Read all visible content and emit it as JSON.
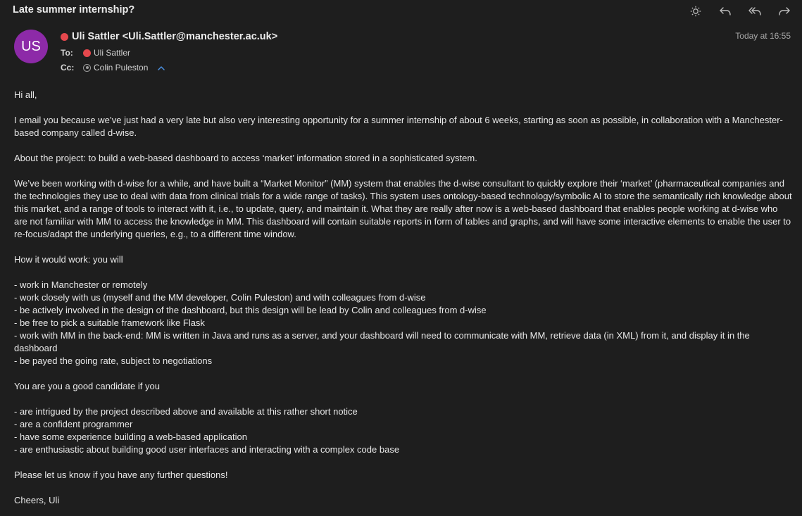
{
  "subject": "Late summer internship?",
  "toolbar": {
    "icons": [
      "brightness-icon",
      "reply-icon",
      "reply-all-icon",
      "forward-icon"
    ]
  },
  "sender": {
    "initials": "US",
    "avatar_color": "#8d2aa8",
    "display": "Uli Sattler <Uli.Sattler@manchester.ac.uk>",
    "status_color": "#e5484d"
  },
  "datetime": "Today at 16:55",
  "recipients": {
    "to_label": "To:",
    "to": "Uli Sattler",
    "cc_label": "Cc:",
    "cc": "Colin Puleston"
  },
  "body": {
    "greeting": "Hi all,",
    "p1": "I email you because we’ve just had a very late but also very interesting opportunity for a summer internship of about 6 weeks, starting as soon as possible, in collaboration with a Manchester-based company called d-wise.",
    "p2": "About the project: to build a web-based dashboard to access ‘market’ information stored in a sophisticated system.",
    "p3": "We’ve been working with d-wise for a while, and have built a “Market Monitor” (MM) system that enables the d-wise consultant to quickly explore their ‘market’ (pharmaceutical companies and the technologies they use to deal with data from clinical trials for a wide range of tasks). This system uses ontology-based technology/symbolic AI to store the semantically rich knowledge about this market, and a range of tools to interact with it, i.e., to update, query, and maintain it. What they are really after now is a web-based dashboard that enables people working at d-wise who are not familiar with MM to access the knowledge in MM. This dashboard will contain suitable reports in form of tables and graphs, and will have some interactive elements to enable the user to re-focus/adapt the underlying queries, e.g., to a different time window.",
    "p4": "How it would work: you will",
    "list1": [
      "- work in Manchester or remotely",
      "- work closely with us (myself and the MM developer, Colin Puleston) and with colleagues from d-wise",
      "- be actively involved in the design of the dashboard, but this design will be lead by Colin and colleagues from d-wise",
      "- be free to pick a suitable framework like Flask",
      "- work with MM in the back-end: MM is written in Java and runs as a server, and your dashboard will need to communicate with MM, retrieve data (in XML) from it, and display it in the dashboard",
      "- be payed the going rate, subject to negotiations"
    ],
    "p5": "You are you a good candidate if you",
    "list2": [
      "- are intrigued by the project described above and available at this rather short notice",
      "- are a confident programmer",
      "- have some experience building a web-based application",
      "- are enthusiastic about building good user interfaces and interacting with a complex code base"
    ],
    "p6": "Please let us know if you have any further questions!",
    "signoff": "Cheers, Uli"
  }
}
